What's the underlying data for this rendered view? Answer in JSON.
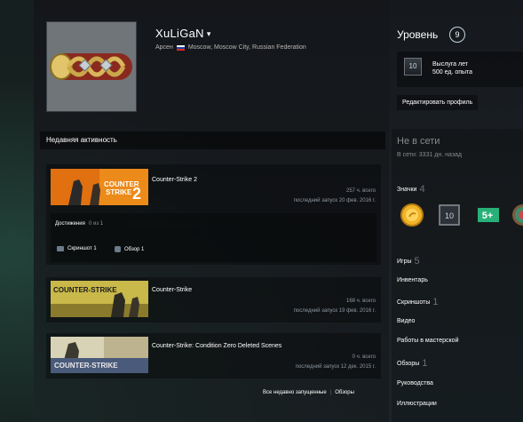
{
  "profile": {
    "persona_name": "XuLiGaN",
    "real_name": "Арсен",
    "location": "Moscow, Moscow City, Russian Federation"
  },
  "level": {
    "label": "Уровень",
    "value": "9"
  },
  "xp_badge": {
    "years": "10",
    "line1": "Выслуга лет",
    "line2": "500 ед. опыта"
  },
  "edit_profile_label": "Редактировать профиль",
  "status": {
    "state": "Не в сети",
    "last_online": "В сети: 3331 дн. назад"
  },
  "badges": {
    "label": "Значки",
    "count": "4",
    "items": [
      "gold-coin-badge",
      "years-service-badge",
      "five-plus-badge",
      "world-badge"
    ],
    "years_text": "10",
    "five_plus_text": "5+"
  },
  "sidebar_links": [
    {
      "label": "Игры",
      "count": "5"
    },
    {
      "label": "Инвентарь",
      "count": ""
    },
    {
      "label": "Скриншоты",
      "count": "1"
    },
    {
      "label": "Видео",
      "count": ""
    },
    {
      "label": "Работы в мастерской",
      "count": ""
    },
    {
      "label": "Обзоры",
      "count": "1"
    },
    {
      "label": "Руководства",
      "count": ""
    },
    {
      "label": "Иллюстрации",
      "count": ""
    }
  ],
  "recent_activity": {
    "title": "Недавняя активность",
    "games": [
      {
        "name": "Counter-Strike 2",
        "hours": "257 ч. всего",
        "last_played": "последний запуск 20 фев. 2016 г.",
        "achievements_label": "Достижения",
        "achievements_count": "0 из 1",
        "achievement_progress": 0,
        "screenshot_label": "Скриншот 1",
        "review_label": "Обзор 1"
      },
      {
        "name": "Counter-Strike",
        "hours": "168 ч. всего",
        "last_played": "последний запуск 19 фев. 2016 г."
      },
      {
        "name": "Counter-Strike: Condition Zero Deleted Scenes",
        "hours": "0 ч. всего",
        "last_played": "последний запуск 12 дек. 2015 г."
      }
    ],
    "all_recent_label": "Все недавно запущенные",
    "reviews_label": "Обзоры"
  },
  "colors": {
    "background": "#1b1e22",
    "link_blue": "#1a9fff",
    "flag_white": "#ffffff",
    "flag_blue": "#1c3fa8",
    "flag_red": "#d52b1e"
  }
}
